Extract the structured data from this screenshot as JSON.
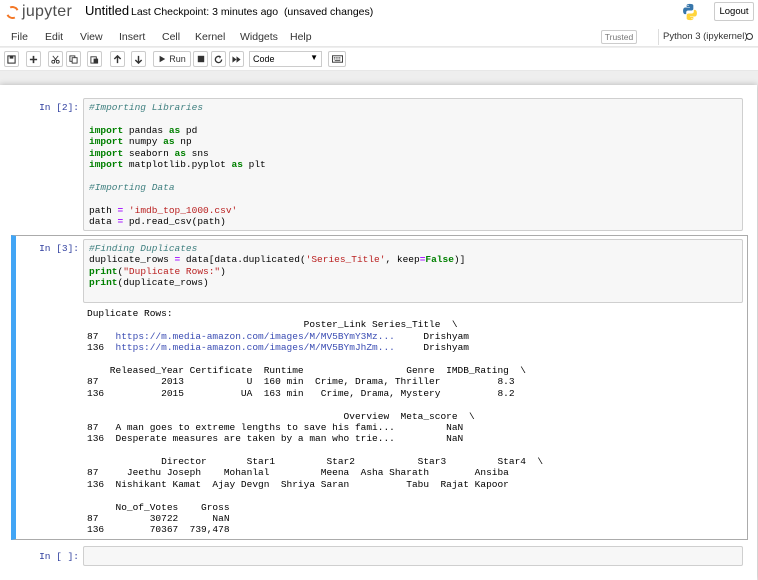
{
  "header": {
    "logo_text": "jupyter",
    "notebook_title": "Untitled",
    "checkpoint": "Last Checkpoint: 3 minutes ago",
    "save_status": "(unsaved changes)",
    "logout_label": "Logout"
  },
  "menu": {
    "items": [
      "File",
      "Edit",
      "View",
      "Insert",
      "Cell",
      "Kernel",
      "Widgets",
      "Help"
    ],
    "trusted_label": "Trusted",
    "kernel_name": "Python 3 (ipykernel)"
  },
  "toolbar": {
    "run_label": "Run",
    "cell_type": "Code",
    "icons": [
      "save-icon",
      "plus-icon",
      "cut-icon",
      "copy-icon",
      "paste-icon",
      "arrow-up-icon",
      "arrow-down-icon",
      "play-icon",
      "stop-icon",
      "restart-icon",
      "fast-forward-icon",
      "keyboard-icon"
    ]
  },
  "cells": [
    {
      "prompt": "In [2]:",
      "code_lines": [
        [
          [
            "#Importing Libraries",
            "comment"
          ]
        ],
        [],
        [
          [
            "import",
            "kw"
          ],
          [
            " pandas ",
            ""
          ],
          [
            "as",
            "kw"
          ],
          [
            " pd",
            ""
          ]
        ],
        [
          [
            "import",
            "kw"
          ],
          [
            " numpy ",
            ""
          ],
          [
            "as",
            "kw"
          ],
          [
            " np",
            ""
          ]
        ],
        [
          [
            "import",
            "kw"
          ],
          [
            " seaborn ",
            ""
          ],
          [
            "as",
            "kw"
          ],
          [
            " sns",
            ""
          ]
        ],
        [
          [
            "import",
            "kw"
          ],
          [
            " matplotlib.pyplot ",
            ""
          ],
          [
            "as",
            "kw"
          ],
          [
            " plt",
            ""
          ]
        ],
        [],
        [
          [
            "#Importing Data",
            "comment"
          ]
        ],
        [],
        [
          [
            "path ",
            ""
          ],
          [
            "=",
            "op"
          ],
          [
            " ",
            ""
          ],
          [
            "'imdb_top_1000.csv'",
            "str"
          ]
        ],
        [
          [
            "data ",
            ""
          ],
          [
            "=",
            "op"
          ],
          [
            " pd.read_csv(path)",
            ""
          ]
        ]
      ]
    },
    {
      "prompt": "In [3]:",
      "code_lines": [
        [
          [
            "#Finding Duplicates",
            "comment"
          ]
        ],
        [
          [
            "duplicate_rows ",
            ""
          ],
          [
            "=",
            "op"
          ],
          [
            " data[data.duplicated(",
            ""
          ],
          [
            "'Series_Title'",
            "str"
          ],
          [
            ", keep",
            ""
          ],
          [
            "=",
            "op"
          ],
          [
            "False",
            "kw"
          ],
          [
            ")]",
            ""
          ]
        ],
        [
          [
            "print",
            "kw"
          ],
          [
            "(",
            ""
          ],
          [
            "\"Duplicate Rows:\"",
            "str"
          ],
          [
            ")",
            ""
          ]
        ],
        [
          [
            "print",
            "kw"
          ],
          [
            "(duplicate_rows)",
            ""
          ]
        ]
      ],
      "output_lines": [
        [
          [
            "Duplicate Rows:",
            ""
          ]
        ],
        [
          [
            "                                      Poster_Link Series_Title  \\",
            ""
          ]
        ],
        [
          [
            "87   ",
            ""
          ],
          [
            "https://m.media-amazon.com/images/M/MV5BYmY3Mz...",
            "link"
          ],
          [
            "     Drishyam",
            ""
          ]
        ],
        [
          [
            "136  ",
            ""
          ],
          [
            "https://m.media-amazon.com/images/M/MV5BYmJhZm...",
            "link"
          ],
          [
            "     Drishyam",
            ""
          ]
        ],
        [],
        [
          [
            "    Released_Year Certificate  Runtime                  Genre  IMDB_Rating  \\",
            ""
          ]
        ],
        [
          [
            "87           2013           U  160 min  Crime, Drama, Thriller          8.3",
            ""
          ]
        ],
        [
          [
            "136          2015          UA  163 min   Crime, Drama, Mystery          8.2",
            ""
          ]
        ],
        [],
        [
          [
            "                                             Overview  Meta_score  \\",
            ""
          ]
        ],
        [
          [
            "87   A man goes to extreme lengths to save his fami...         NaN",
            ""
          ]
        ],
        [
          [
            "136  Desperate measures are taken by a man who trie...         NaN",
            ""
          ]
        ],
        [],
        [
          [
            "             Director       Star1         Star2           Star3         Star4  \\",
            ""
          ]
        ],
        [
          [
            "87     Jeethu Joseph    Mohanlal         Meena  Asha Sharath        Ansiba",
            ""
          ]
        ],
        [
          [
            "136  Nishikant Kamat  Ajay Devgn  Shriya Saran          Tabu  Rajat Kapoor",
            ""
          ]
        ],
        [],
        [
          [
            "     No_of_Votes    Gross",
            ""
          ]
        ],
        [
          [
            "87         30722      NaN",
            ""
          ]
        ],
        [
          [
            "136        70367  739,478",
            ""
          ]
        ]
      ]
    },
    {
      "prompt": "In [ ]:"
    }
  ]
}
